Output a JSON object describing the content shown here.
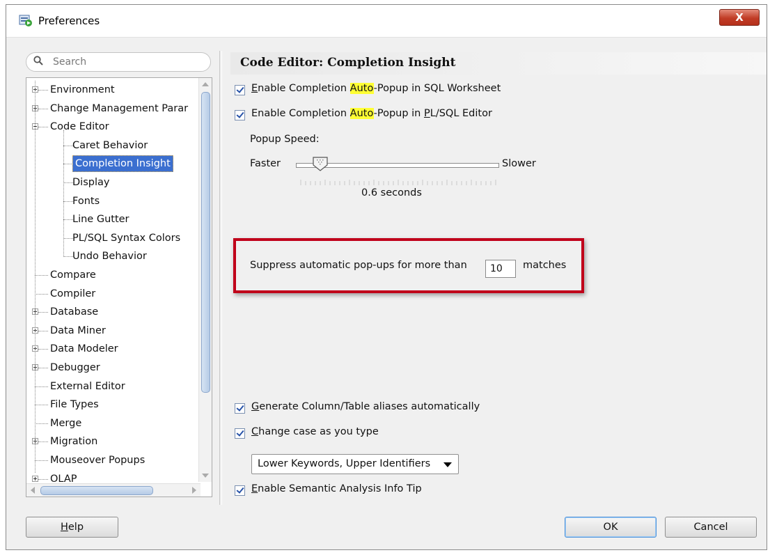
{
  "window": {
    "title": "Preferences",
    "close_label": "X"
  },
  "search": {
    "placeholder": "Search"
  },
  "tree": {
    "items": [
      {
        "label": "Environment",
        "level": 0,
        "expander": "plus"
      },
      {
        "label": "Change Management Parar",
        "level": 0,
        "expander": "plus"
      },
      {
        "label": "Code Editor",
        "level": 0,
        "expander": "minus"
      },
      {
        "label": "Caret Behavior",
        "level": 1
      },
      {
        "label": "Completion Insight",
        "level": 1,
        "selected": true
      },
      {
        "label": "Display",
        "level": 1
      },
      {
        "label": "Fonts",
        "level": 1
      },
      {
        "label": "Line Gutter",
        "level": 1
      },
      {
        "label": "PL/SQL Syntax Colors",
        "level": 1
      },
      {
        "label": "Undo Behavior",
        "level": 1
      },
      {
        "label": "Compare",
        "level": 0
      },
      {
        "label": "Compiler",
        "level": 0
      },
      {
        "label": "Database",
        "level": 0,
        "expander": "plus"
      },
      {
        "label": "Data Miner",
        "level": 0,
        "expander": "plus"
      },
      {
        "label": "Data Modeler",
        "level": 0,
        "expander": "plus"
      },
      {
        "label": "Debugger",
        "level": 0,
        "expander": "plus"
      },
      {
        "label": "External Editor",
        "level": 0
      },
      {
        "label": "File Types",
        "level": 0
      },
      {
        "label": "Merge",
        "level": 0
      },
      {
        "label": "Migration",
        "level": 0,
        "expander": "plus"
      },
      {
        "label": "Mouseover Popups",
        "level": 0
      },
      {
        "label": "OLAP",
        "level": 0,
        "expander": "plus"
      }
    ]
  },
  "panel": {
    "title": "Code Editor: Completion Insight",
    "cb1": {
      "pre_mn": "E",
      "pre": "nable Completion ",
      "hl": "Auto",
      "post": "-Popup in SQL Worksheet",
      "checked": true
    },
    "cb2": {
      "pre_mn": "Enable Completion ",
      "hl": "Auto",
      "post_a": "-Popup in ",
      "post_mn": "P",
      "post_b": "L/SQL Editor",
      "checked": true
    },
    "popup_speed_label": "Popup Speed:",
    "faster_label": "Faster",
    "slower_label": "Slower",
    "slider_value": 0.12,
    "seconds_label": "0.6 seconds",
    "suppress_label": "Suppress automatic pop-ups for more than",
    "suppress_value": "10",
    "matches_label": "matches",
    "cb3": {
      "mn": "G",
      "rest": "enerate Column/Table aliases automatically",
      "checked": true
    },
    "cb4": {
      "mn": "C",
      "rest": "hange case as you type",
      "checked": true
    },
    "case_dropdown": "Lower Keywords, Upper Identifiers",
    "cb5": {
      "mn": "E",
      "rest": "nable Semantic Analysis Info Tip",
      "checked": true
    }
  },
  "buttons": {
    "help_mn": "H",
    "help_rest": "elp",
    "ok": "OK",
    "cancel": "Cancel"
  }
}
